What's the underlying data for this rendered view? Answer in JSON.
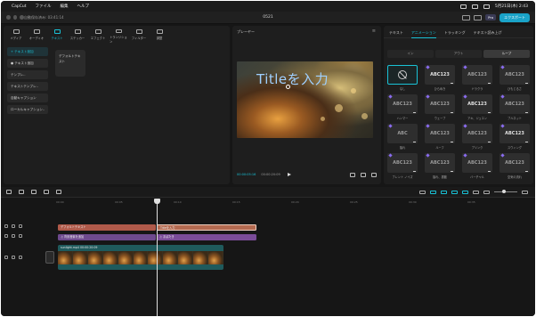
{
  "menubar": {
    "app": "CapCut",
    "items": [
      "ファイル",
      "編集",
      "ヘルプ"
    ],
    "clock": "5月21日(木) 2:43"
  },
  "titlebar": {
    "project": "自動保存済み: 03:41:14",
    "title": "0521",
    "pro": "Pro",
    "export": "エクスポート"
  },
  "left_panel": {
    "tools": [
      "メディア",
      "オーディオ",
      "テキスト",
      "ステッカー",
      "エフェクト",
      "トランジション",
      "フィルター",
      "調整"
    ],
    "active_tool": "テキスト",
    "categories": [
      "+ テキスト追加",
      "● テキスト追加",
      "テンプレ..",
      "テキストテンプレ..",
      "自動キャプション",
      "ローカルキャプション.."
    ],
    "card_label": "デフォルトテキスト"
  },
  "player": {
    "title": "プレーヤー",
    "menu": "≡",
    "overlay_title": "Titleを入力",
    "timecode_current": "00:00:05:16",
    "timecode_duration": "00:00:20:09"
  },
  "right_panel": {
    "tabs": [
      "テキスト",
      "アニメーション",
      "トラッキング",
      "テキスト読み上げ"
    ],
    "active_tab": "アニメーション",
    "segments": [
      "イン",
      "アウト",
      "ループ"
    ],
    "active_segment": "ループ",
    "animations": [
      {
        "label": "なし",
        "thumb": "",
        "selected": true
      },
      {
        "label": "ひらめき",
        "thumb": "ABC123"
      },
      {
        "label": "ドラクラ",
        "thumb": "ABC123"
      },
      {
        "label": "ひもじるさ",
        "thumb": "ABC123"
      },
      {
        "label": "ハンマー",
        "thumb": "ABC123"
      },
      {
        "label": "ウェーブ",
        "thumb": "ABC123"
      },
      {
        "label": "アキ、ジュエン",
        "thumb": "ABC123"
      },
      {
        "label": "ブルネット",
        "thumb": "ABC123"
      },
      {
        "label": "揺れ",
        "thumb": "ABC"
      },
      {
        "label": "ルーフ",
        "thumb": "ABC123"
      },
      {
        "label": "ブリンク",
        "thumb": "ABC123"
      },
      {
        "label": "スウィング",
        "thumb": "ABC123"
      },
      {
        "label": "ブレント ノイズ",
        "thumb": "ABC123"
      },
      {
        "label": "揺れ、振動",
        "thumb": "ABC123"
      },
      {
        "label": "バーチャル",
        "thumb": "ABC123"
      },
      {
        "label": "空気の流れ",
        "thumb": "ABC123"
      }
    ]
  },
  "timeline": {
    "ruler": [
      "00:00",
      "00:05",
      "00:10",
      "00:15",
      "00:20",
      "00:25",
      "00:30",
      "00:35"
    ],
    "text_clips": [
      "デフォルトテキスト",
      "Titleを入力"
    ],
    "fx_clips": [
      "♫ 背景音楽を追加",
      "♫ まばたき"
    ],
    "video_clip_label": "sunlight.mp4  00:00:20:09"
  }
}
